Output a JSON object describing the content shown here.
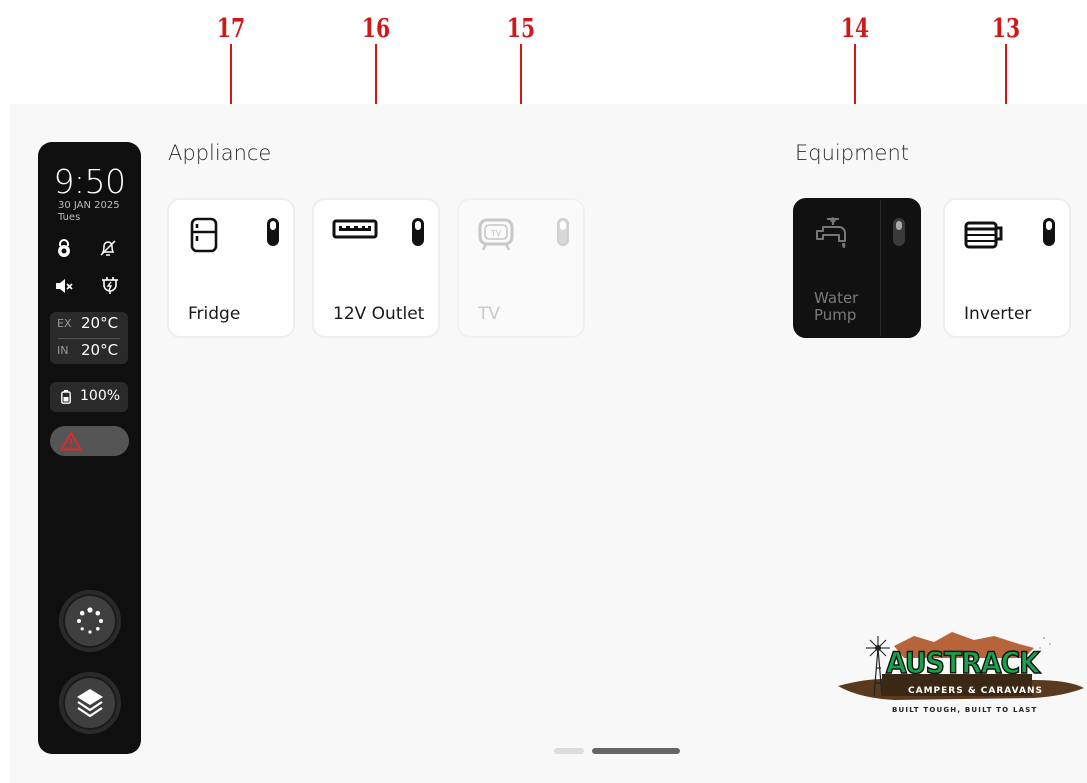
{
  "callouts": [
    {
      "num": "17"
    },
    {
      "num": "16"
    },
    {
      "num": "15"
    },
    {
      "num": "14"
    },
    {
      "num": "13"
    }
  ],
  "sidebar": {
    "time": "9:50",
    "date": "30 JAN 2025",
    "day": "Tues",
    "icons": [
      "lock-icon",
      "bell-off-icon",
      "mute-icon",
      "plug-icon"
    ],
    "temps": {
      "ex_label": "EX",
      "ex_value": "20°C",
      "in_label": "IN",
      "in_value": "20°C"
    },
    "battery": {
      "value": "100%"
    },
    "alert_icon": "warning-icon",
    "buttons": [
      "loading-button",
      "layers-button"
    ]
  },
  "appliance": {
    "title": "Appliance",
    "cards": [
      {
        "label": "Fridge",
        "icon": "fridge-icon",
        "state": "off"
      },
      {
        "label": "12V Outlet",
        "icon": "usb-outlet-icon",
        "state": "off"
      },
      {
        "label": "TV",
        "icon": "tv-icon",
        "state": "disabled"
      }
    ]
  },
  "equipment": {
    "title": "Equipment",
    "cards": [
      {
        "label": "Water Pump",
        "label_line1": "Water",
        "label_line2": "Pump",
        "icon": "tap-icon",
        "state": "selected"
      },
      {
        "label": "Inverter",
        "icon": "inverter-icon",
        "state": "off"
      }
    ]
  },
  "logo": {
    "name": "AUSTRACK",
    "sub": "CAMPERS & CARAVANS",
    "tagline": "BUILT TOUGH, BUILT TO LAST"
  },
  "colors": {
    "accent_red": "#d01818",
    "logo_green": "#16a34a",
    "alert_red": "#e0282a"
  }
}
